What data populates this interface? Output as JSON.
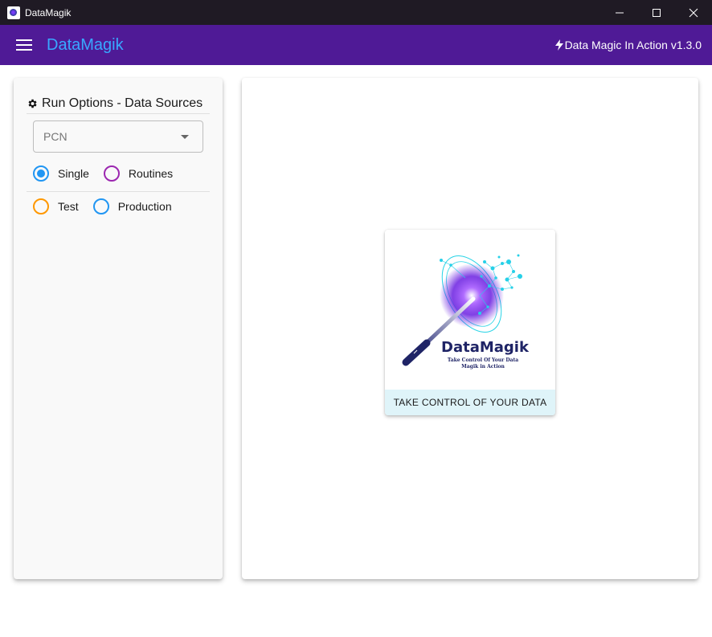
{
  "window": {
    "title": "DataMagik",
    "icon": "app-logo-icon",
    "controls": [
      "minimize-icon",
      "maximize-icon",
      "close-icon"
    ]
  },
  "appbar": {
    "menu_icon": "hamburger-menu-icon",
    "brand": "DataMagik",
    "version_icon": "lightning-bolt-icon",
    "version_text": "Data Magic In Action v1.3.0"
  },
  "sidebar": {
    "header_icon": "gear-icon",
    "header": "Run Options - Data Sources",
    "source_select": {
      "value": "PCN",
      "icon": "caret-down-icon"
    },
    "mode_options": [
      {
        "label": "Single",
        "checked": true,
        "color": "#2196f3"
      },
      {
        "label": "Routines",
        "checked": false,
        "color": "#9c27b0"
      }
    ],
    "env_options": [
      {
        "label": "Test",
        "checked": false,
        "color": "#ff9800"
      },
      {
        "label": "Production",
        "checked": false,
        "color": "#2196f3"
      }
    ]
  },
  "main": {
    "logo": {
      "brand": "DataMagik",
      "tagline_1": "Take Control Of Your Data",
      "tagline_2": "Magik in Action"
    },
    "caption": "TAKE CONTROL OF YOUR DATA"
  },
  "colors": {
    "titlebar": "#1f1a24",
    "appbar": "#4f1a96",
    "brand_text": "#38a8ff",
    "caption_bg": "#dff4f9"
  }
}
